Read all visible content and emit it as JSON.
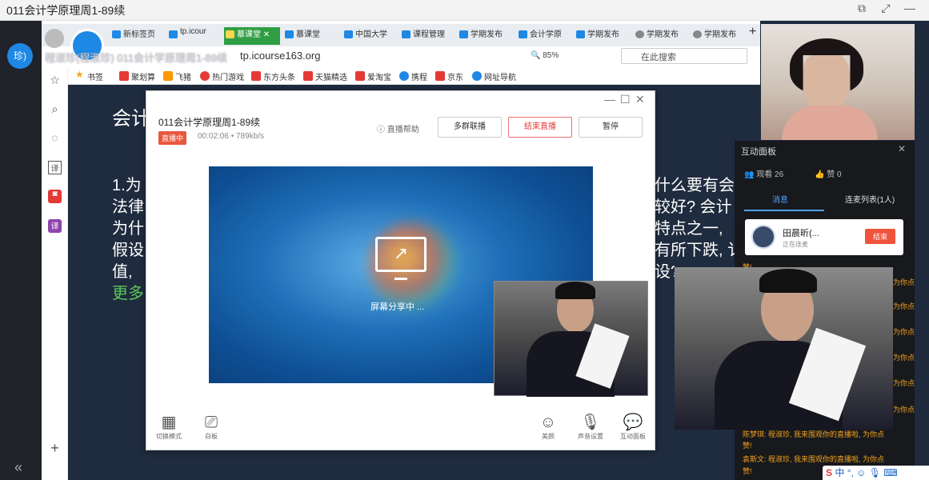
{
  "window": {
    "title": "011会计学原理周1-89续",
    "controls": [
      "⧉",
      "⤢",
      "—"
    ]
  },
  "app_sidebar": {
    "avatar_text": "珍)"
  },
  "browser": {
    "tabs": [
      {
        "label": "新标签页",
        "color": "#1e88e5"
      },
      {
        "label": "tp.icour",
        "color": "#1e88e5"
      },
      {
        "label": "慕课堂",
        "color": "#2f9e44",
        "active": true
      },
      {
        "label": "慕课堂",
        "color": "#1e88e5"
      },
      {
        "label": "中国大学",
        "color": "#1e88e5"
      },
      {
        "label": "课程管理",
        "color": "#1e88e5"
      },
      {
        "label": "学期发布",
        "color": "#1e88e5"
      },
      {
        "label": "会计学原",
        "color": "#1e88e5"
      },
      {
        "label": "学期发布",
        "color": "#1e88e5"
      },
      {
        "label": "学期发布",
        "color": "#888888"
      },
      {
        "label": "学期发布",
        "color": "#888888"
      }
    ],
    "new_tab": "+",
    "tab_title_overlay": "程淑珍(程淑珍) 011会计学原理周1-89续",
    "url": "tp.icourse163.org",
    "zoom": "85%",
    "search_placeholder": "在此搜索",
    "bookmarks": [
      {
        "label": "书签",
        "color": "#f5a623"
      },
      {
        "label": "聚划算",
        "color": "#e53935"
      },
      {
        "label": "飞猪",
        "color": "#ff9800"
      },
      {
        "label": "热门游戏",
        "color": "#e53935"
      },
      {
        "label": "东方头条",
        "color": "#e53935"
      },
      {
        "label": "天猫精选",
        "color": "#e53935"
      },
      {
        "label": "爱淘宝",
        "color": "#e53935"
      },
      {
        "label": "携程",
        "color": "#1e88e5"
      },
      {
        "label": "京东",
        "color": "#e53935"
      },
      {
        "label": "网址导航",
        "color": "#1e88e5"
      }
    ]
  },
  "slide": {
    "title": "会计",
    "lines": [
      "1.为",
      "法律",
      "为什",
      "假设",
      "值,"
    ],
    "right_fragments": [
      "什么要有会计",
      "较好? 会计",
      "特点之一,",
      "有所下跌, 讠",
      "设? 离了经"
    ],
    "more": "更多"
  },
  "live_dialog": {
    "course": "011会计学原理周1-89续",
    "badge": "直播中",
    "status": "00:02:06 • 789kb/s",
    "help": "直播帮助",
    "buttons": {
      "multi": "多群联播",
      "end": "结束直播",
      "pause": "暂停"
    },
    "share_text": "屏幕分享中 ...",
    "tools": [
      {
        "label": "切换模式",
        "glyph": "▦"
      },
      {
        "label": "白板",
        "glyph": "⎚"
      },
      {
        "label": "美颜",
        "glyph": "☺"
      },
      {
        "label": "声音设置",
        "glyph": "🎙"
      },
      {
        "label": "互动面板",
        "glyph": "💬"
      }
    ]
  },
  "panel": {
    "title": "互动面板",
    "watch": "观看 26",
    "like": "赞 0",
    "tabs": [
      "消息",
      "连麦列表(1人)"
    ],
    "guest_name": "田晨昕(...",
    "guest_status": "正在连麦",
    "end_label": "结束",
    "side_fragment": "赞!",
    "right_fragments": [
      "为你点",
      "为你点",
      "为你点",
      "为你点",
      "为你点",
      "为你点",
      "为你点"
    ],
    "messages": [
      "陈梦琪: 程淑珍, 我来围观你的直播啦, 为你点",
      "赞!",
      "袁斯文: 程淑珍, 我来围观你的直播啦, 为你点",
      "赞!"
    ]
  },
  "ime": {
    "brand": "S",
    "text": "中 °, ☺ 🎙 ⌨"
  }
}
